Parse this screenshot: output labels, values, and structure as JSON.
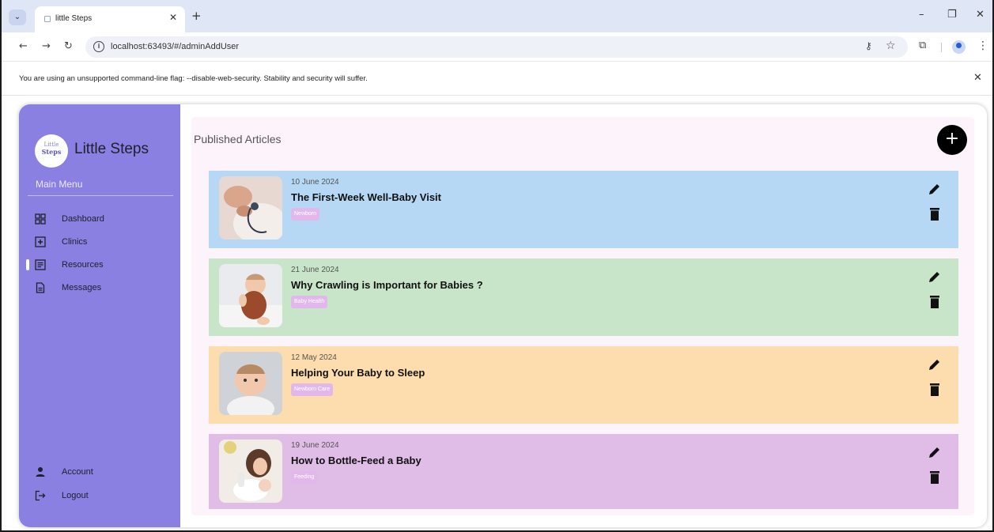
{
  "browser": {
    "tab_title": "little Steps",
    "url": "localhost:63493/#/adminAddUser",
    "infobar_message": "You are using an unsupported command-line flag: --disable-web-security. Stability and security will suffer."
  },
  "sidebar": {
    "logo_line1": "Little",
    "logo_line2": "Steps",
    "brand": "Little Steps",
    "menu_label": "Main Menu",
    "items": [
      {
        "label": "Dashboard",
        "icon": "dashboard-icon",
        "active": false
      },
      {
        "label": "Clinics",
        "icon": "clinic-plus-icon",
        "active": false
      },
      {
        "label": "Resources",
        "icon": "resources-icon",
        "active": true
      },
      {
        "label": "Messages",
        "icon": "messages-icon",
        "active": false
      }
    ],
    "bottom_items": [
      {
        "label": "Account",
        "icon": "person-icon"
      },
      {
        "label": "Logout",
        "icon": "logout-icon"
      }
    ]
  },
  "main": {
    "section_title": "Published Articles",
    "add_label": "+",
    "articles": [
      {
        "date": "10 June 2024",
        "title": "The First-Week Well-Baby Visit",
        "tag": "Newborn",
        "bg": "#b6d8f4"
      },
      {
        "date": "21 June 2024",
        "title": "Why Crawling is Important for Babies ?",
        "tag": "Baby Health",
        "bg": "#c8e5c9"
      },
      {
        "date": "12 May 2024",
        "title": "Helping Your Baby to Sleep",
        "tag": "Newborn Care",
        "bg": "#fddcad"
      },
      {
        "date": "19 June 2024",
        "title": "How to Bottle-Feed a Baby",
        "tag": "Feeding",
        "bg": "#e0bde6"
      }
    ]
  },
  "colors": {
    "sidebar": "#8a80e2",
    "content_bg": "#fdf4fb",
    "tag": "#e2b7ec",
    "accent_button": "#000000"
  }
}
